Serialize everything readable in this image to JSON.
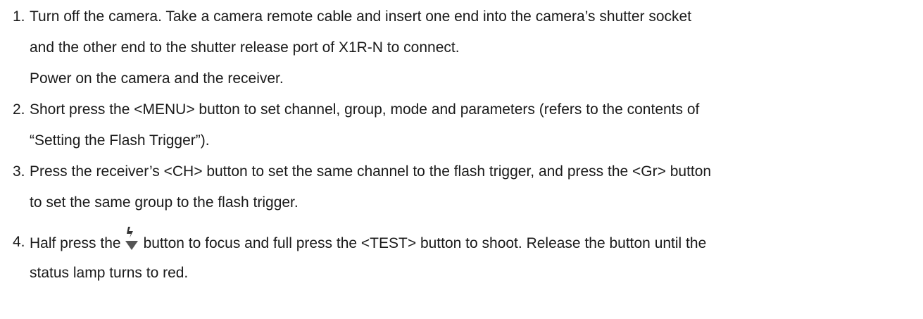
{
  "steps": [
    {
      "number": "1.",
      "lines": [
        "Turn off the camera. Take a camera remote cable and insert one end into the camera’s shutter socket",
        "and the other end to the shutter release port of X1R-N to connect.",
        "Power on the camera and the receiver."
      ]
    },
    {
      "number": "2.",
      "lines": [
        "Short press the <MENU> button to set channel, group, mode and parameters (refers to the contents of",
        "“Setting the Flash Trigger”)."
      ]
    },
    {
      "number": "3.",
      "lines": [
        "Press the receiver’s <CH> button to set the same channel to the flash trigger, and press the <Gr> button",
        "to set the same group to the flash trigger."
      ]
    },
    {
      "number": "4.",
      "line1_before": "Half press the",
      "line1_after": "button to focus and full press the <TEST> button to shoot. Release the button until the",
      "icon": "flash-focus-icon",
      "line2": "status lamp turns to red."
    }
  ]
}
